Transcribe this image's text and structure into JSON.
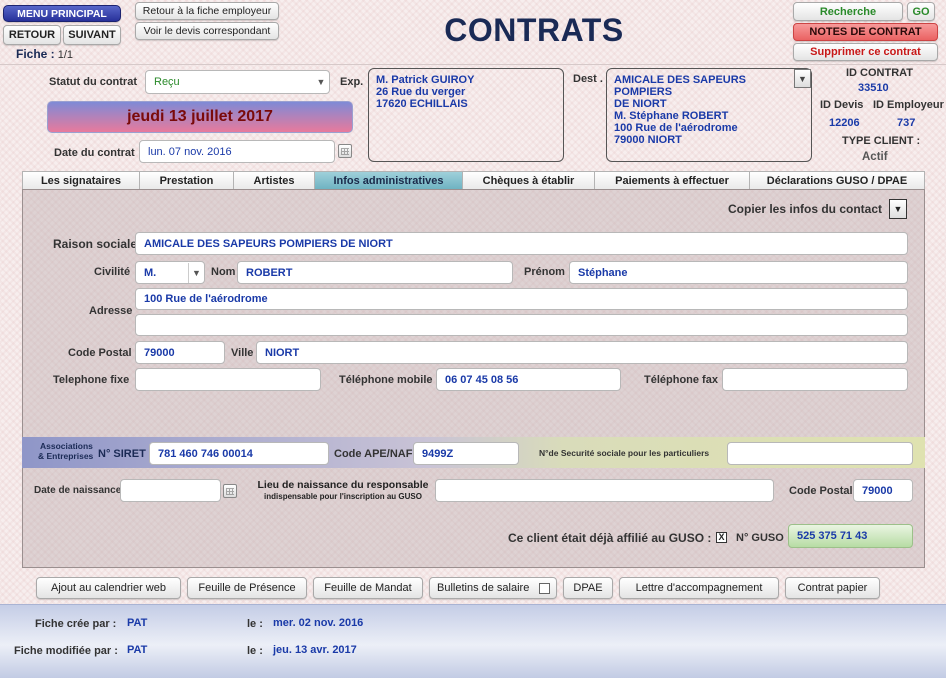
{
  "header": {
    "menu_principal": "MENU PRINCIPAL",
    "retour": "RETOUR",
    "suivant": "SUIVANT",
    "retour_fiche_employeur": "Retour à la fiche employeur",
    "voir_devis": "Voir le devis correspondant",
    "title": "CONTRATS",
    "fiche_label": "Fiche :",
    "fiche_value": "1/1",
    "recherche": "Recherche",
    "go": "GO",
    "notes": "NOTES DE CONTRAT",
    "supprimer": "Supprimer ce contrat"
  },
  "info": {
    "statut_label": "Statut du contrat",
    "statut_value": "Reçu",
    "date_banner": "jeudi 13 juillet 2017",
    "date_contrat_label": "Date du contrat",
    "date_contrat_value": "lun. 07 nov. 2016",
    "exp_label": "Exp.",
    "exp_lines": [
      "M. Patrick GUIROY",
      "26 Rue du verger",
      "17620 ECHILLAIS"
    ],
    "dest_label": "Dest .",
    "dest_lines": [
      "AMICALE DES SAPEURS POMPIERS",
      "DE NIORT",
      "M. Stéphane ROBERT",
      "100 Rue de l'aérodrome",
      "79000 NIORT"
    ],
    "id_contrat_label": "ID CONTRAT",
    "id_contrat_value": "33510",
    "id_devis_label": "ID Devis",
    "id_devis_value": "12206",
    "id_employeur_label": "ID Employeur",
    "id_employeur_value": "737",
    "type_client_label": "TYPE CLIENT :",
    "type_client_value": "Actif"
  },
  "tabs": [
    "Les signataires",
    "Prestation",
    "Artistes",
    "Infos administratives",
    "Chèques à établir",
    "Paiements à effectuer",
    "Déclarations GUSO / DPAE"
  ],
  "form": {
    "copier": "Copier les infos du contact",
    "raison_label": "Raison sociale",
    "raison_value": "AMICALE DES SAPEURS POMPIERS DE NIORT",
    "civilite_label": "Civilité",
    "civilite_value": "M.",
    "nom_label": "Nom",
    "nom_value": "ROBERT",
    "prenom_label": "Prénom",
    "prenom_value": "Stéphane",
    "adresse_label": "Adresse",
    "adresse_value1": "100 Rue de l'aérodrome",
    "adresse_value2": "",
    "cp_label": "Code Postal",
    "cp_value": "79000",
    "ville_label": "Ville",
    "ville_value": "NIORT",
    "tel_fixe_label": "Telephone fixe",
    "tel_fixe_value": "",
    "tel_mobile_label": "Téléphone mobile",
    "tel_mobile_value": "06 07 45 08 56",
    "tel_fax_label": "Téléphone fax",
    "tel_fax_value": "",
    "assoc_line1": "Associations",
    "assoc_line2": "& Entreprises",
    "siret_label": "N° SIRET",
    "siret_value": "781 460 746 00014",
    "ape_label": "Code APE/NAF",
    "ape_value": "9499Z",
    "secu_label": "N°de Securité sociale pour les particuliers",
    "secu_value": "",
    "naissance_label": "Date de naissance",
    "naissance_value": "",
    "lieu_label1": "Lieu de naissance du responsable",
    "lieu_label2": "indispensable pour l'inscription au GUSO",
    "lieu_value": "",
    "cp2_label": "Code Postal",
    "cp2_value": "79000",
    "guso_affilie_label": "Ce client était déjà affilié au GUSO :",
    "guso_check": "X",
    "guso_num_label": "N° GUSO",
    "guso_num_value": "525 375 71 43"
  },
  "actions": {
    "ajout_calendrier": "Ajout au calendrier web",
    "presence": "Feuille de Présence",
    "mandat": "Feuille de Mandat",
    "bulletins": "Bulletins de salaire",
    "dpae": "DPAE",
    "lettre": "Lettre d'accompagnement",
    "contrat_papier": "Contrat papier"
  },
  "footer": {
    "cree_label": "Fiche crée par :",
    "cree_by": "PAT",
    "le1": "le :",
    "cree_date": "mer. 02 nov. 2016",
    "modif_label": "Fiche modifiée par :",
    "modif_by": "PAT",
    "le2": "le :",
    "modif_date": "jeu. 13 avr. 2017"
  },
  "colors": {
    "title": "#1a2a55",
    "field_text": "#1a3aa8",
    "notes_bg": "#f07878",
    "tab_active": "#7fbccb",
    "green_text": "#2a8a2a"
  }
}
